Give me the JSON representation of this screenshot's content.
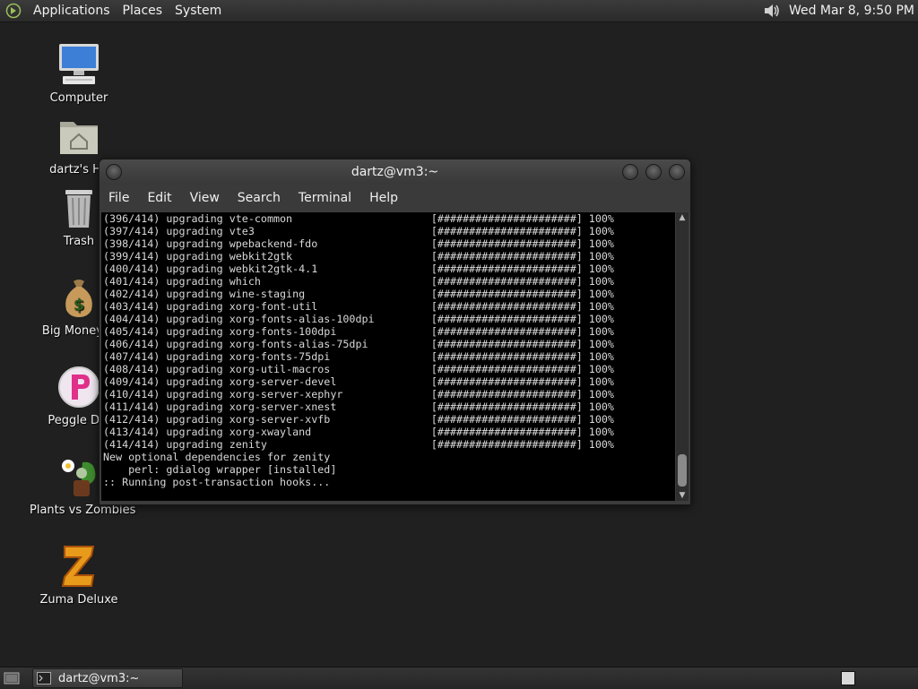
{
  "top_panel": {
    "menus": [
      "Applications",
      "Places",
      "System"
    ],
    "clock": "Wed Mar  8,  9:50 PM"
  },
  "desktop_icons": [
    {
      "label": "Computer",
      "icon": "computer-icon"
    },
    {
      "label": "dartz's Ho",
      "icon": "home-folder-icon"
    },
    {
      "label": "Trash",
      "icon": "trash-icon"
    },
    {
      "label": "Big Money D",
      "icon": "money-bag-icon"
    },
    {
      "label": "Peggle Del",
      "icon": "peggle-icon"
    },
    {
      "label": "Plants vs Zombies",
      "icon": "plants-vs-zombies-icon"
    },
    {
      "label": "Zuma Deluxe",
      "icon": "zuma-icon"
    }
  ],
  "terminal": {
    "title": "dartz@vm3:~",
    "menu": [
      "File",
      "Edit",
      "View",
      "Search",
      "Terminal",
      "Help"
    ],
    "lines": [
      "(396/414) upgrading vte-common                      [######################] 100%",
      "(397/414) upgrading vte3                            [######################] 100%",
      "(398/414) upgrading wpebackend-fdo                  [######################] 100%",
      "(399/414) upgrading webkit2gtk                      [######################] 100%",
      "(400/414) upgrading webkit2gtk-4.1                  [######################] 100%",
      "(401/414) upgrading which                           [######################] 100%",
      "(402/414) upgrading wine-staging                    [######################] 100%",
      "(403/414) upgrading xorg-font-util                  [######################] 100%",
      "(404/414) upgrading xorg-fonts-alias-100dpi         [######################] 100%",
      "(405/414) upgrading xorg-fonts-100dpi               [######################] 100%",
      "(406/414) upgrading xorg-fonts-alias-75dpi          [######################] 100%",
      "(407/414) upgrading xorg-fonts-75dpi                [######################] 100%",
      "(408/414) upgrading xorg-util-macros                [######################] 100%",
      "(409/414) upgrading xorg-server-devel               [######################] 100%",
      "(410/414) upgrading xorg-server-xephyr              [######################] 100%",
      "(411/414) upgrading xorg-server-xnest               [######################] 100%",
      "(412/414) upgrading xorg-server-xvfb                [######################] 100%",
      "(413/414) upgrading xorg-xwayland                   [######################] 100%",
      "(414/414) upgrading zenity                          [######################] 100%",
      "New optional dependencies for zenity",
      "    perl: gdialog wrapper [installed]",
      ":: Running post-transaction hooks..."
    ]
  },
  "taskbar": {
    "task_label": "dartz@vm3:~"
  },
  "colors": {
    "desktop_bg": "#1f201f",
    "terminal_bg": "#000000",
    "terminal_fg": "#d8d8d8"
  }
}
